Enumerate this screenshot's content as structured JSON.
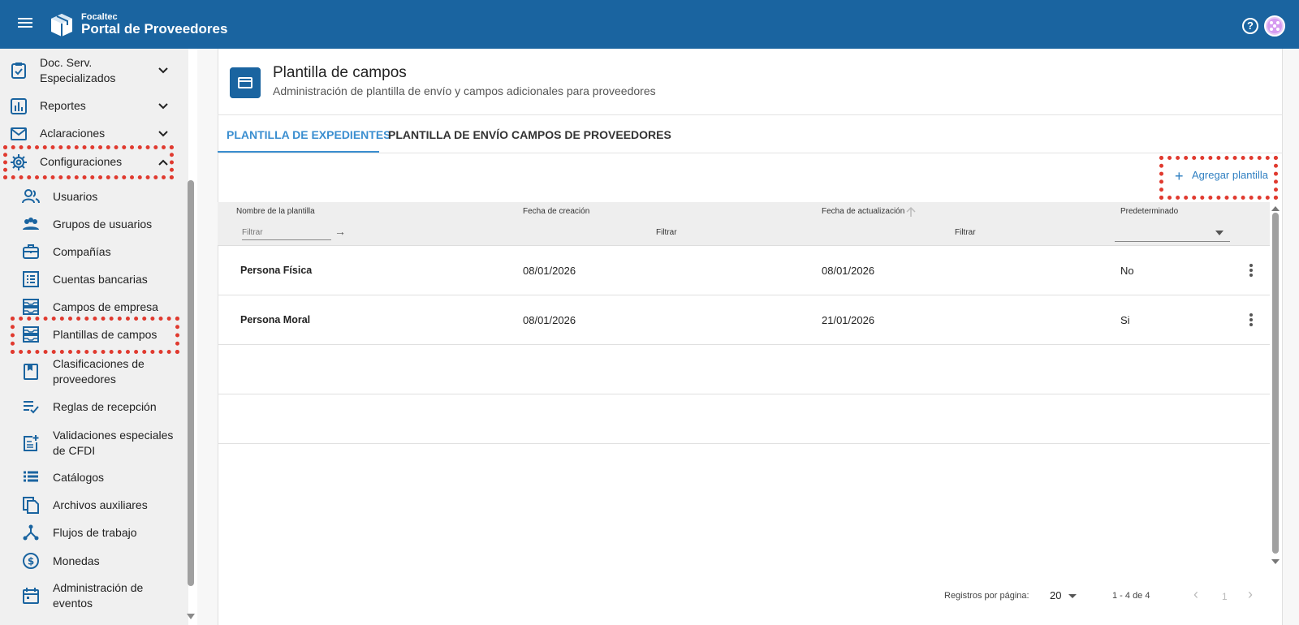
{
  "header": {
    "brand_small": "Focaltec",
    "brand_big": "Portal de Proveedores",
    "help_symbol": "?"
  },
  "sidebar": {
    "items": [
      {
        "label": "Doc. Serv. Especializados",
        "icon": "clipboard-check-icon",
        "expandable": true,
        "expanded": false
      },
      {
        "label": "Reportes",
        "icon": "bar-chart-icon",
        "expandable": true,
        "expanded": false
      },
      {
        "label": "Aclaraciones",
        "icon": "mail-icon",
        "expandable": true,
        "expanded": false
      },
      {
        "label": "Configuraciones",
        "icon": "gear-icon",
        "expandable": true,
        "expanded": true
      }
    ],
    "sub_items": [
      {
        "label": "Usuarios",
        "icon": "users-icon"
      },
      {
        "label": "Grupos de usuarios",
        "icon": "user-group-icon"
      },
      {
        "label": "Compañías",
        "icon": "briefcase-icon"
      },
      {
        "label": "Cuentas bancarias",
        "icon": "list-box-icon"
      },
      {
        "label": "Campos de empresa",
        "icon": "inbox-stack-icon"
      },
      {
        "label": "Plantillas de campos",
        "icon": "inbox-stack-icon"
      },
      {
        "label": "Clasificaciones de proveedores",
        "icon": "bookmark-book-icon"
      },
      {
        "label": "Reglas de recepción",
        "icon": "checklist-icon"
      },
      {
        "label": "Validaciones especiales de CFDI",
        "icon": "post-add-icon"
      },
      {
        "label": "Catálogos",
        "icon": "list-icon"
      },
      {
        "label": "Archivos auxiliares",
        "icon": "files-copy-icon"
      },
      {
        "label": "Flujos de trabajo",
        "icon": "workflow-icon"
      },
      {
        "label": "Monedas",
        "icon": "dollar-coin-icon"
      },
      {
        "label": "Administración de eventos",
        "icon": "calendar-icon"
      }
    ]
  },
  "page": {
    "title": "Plantilla de campos",
    "subtitle": "Administración de plantilla de envío y campos adicionales para proveedores",
    "icon": "card-icon"
  },
  "tabs": [
    {
      "label": "PLANTILLA DE EXPEDIENTES",
      "active": true
    },
    {
      "label": "PLANTILLA DE ENVÍO",
      "active": false
    },
    {
      "label": "CAMPOS DE PROVEEDORES",
      "active": false
    }
  ],
  "actions": {
    "add_label": "Agregar plantilla",
    "add_symbol": "+"
  },
  "table": {
    "columns": [
      "Nombre de la plantilla",
      "Fecha de creación",
      "Fecha de actualización",
      "Predeterminado"
    ],
    "filter_placeholder": "Filtrar",
    "filter_labels": [
      "Filtrar",
      "Filtrar"
    ],
    "rows": [
      {
        "name": "Persona Física",
        "created": "08/01/2026",
        "updated": "08/01/2026",
        "default": "No"
      },
      {
        "name": "Persona Moral",
        "created": "08/01/2026",
        "updated": "21/01/2026",
        "default": "Si"
      }
    ]
  },
  "pager": {
    "label": "Registros por página:",
    "page_size": "20",
    "range": "1 - 4 de 4",
    "page": "1"
  },
  "colors": {
    "header_bg": "#1a64a0",
    "accent": "#3a8ed0",
    "highlight": "#e03a2f"
  }
}
